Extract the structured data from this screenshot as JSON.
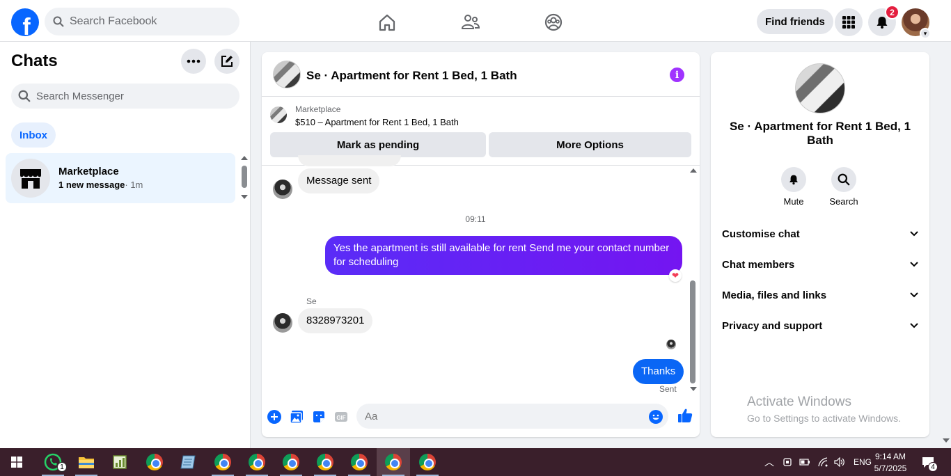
{
  "topbar": {
    "logo_letter": "f",
    "search_placeholder": "Search Facebook",
    "find_friends_label": "Find friends",
    "notification_count": "2"
  },
  "sidebar": {
    "title": "Chats",
    "search_placeholder": "Search Messenger",
    "inbox_label": "Inbox",
    "chats": [
      {
        "name": "Marketplace",
        "preview": "1 new message",
        "time": "· 1m"
      }
    ]
  },
  "conversation": {
    "title": "Se · Apartment for Rent 1 Bed, 1 Bath",
    "marketplace_label": "Marketplace",
    "listing": "$510 – Apartment for Rent 1 Bed, 1 Bath",
    "mark_pending_label": "Mark as pending",
    "more_options_label": "More Options",
    "messages": {
      "incoming_1": "Message sent",
      "timestamp": "09:11",
      "outgoing_1": "Yes the apartment is still available for rent Send me your contact number for scheduling",
      "sender_name": "Se",
      "incoming_2": "8328973201",
      "outgoing_2": "Thanks",
      "status": "Sent"
    },
    "composer_placeholder": "Aa"
  },
  "details": {
    "title": "Se · Apartment for Rent 1 Bed, 1 Bath",
    "mute_label": "Mute",
    "search_label": "Search",
    "sections": [
      "Customise chat",
      "Chat members",
      "Media, files and links",
      "Privacy and support"
    ]
  },
  "watermark": {
    "line1": "Activate Windows",
    "line2": "Go to Settings to activate Windows."
  },
  "taskbar": {
    "whatsapp_badge": "1",
    "language": "ENG",
    "time": "9:14 AM",
    "date": "5/7/2025",
    "notification_count": "4"
  },
  "colors": {
    "brand_blue": "#0866ff",
    "outgoing_purple": "#6a1cf5",
    "outgoing_blue": "#0a66f5",
    "info_purple": "#a033ff",
    "taskbar": "#3a1f2b"
  }
}
